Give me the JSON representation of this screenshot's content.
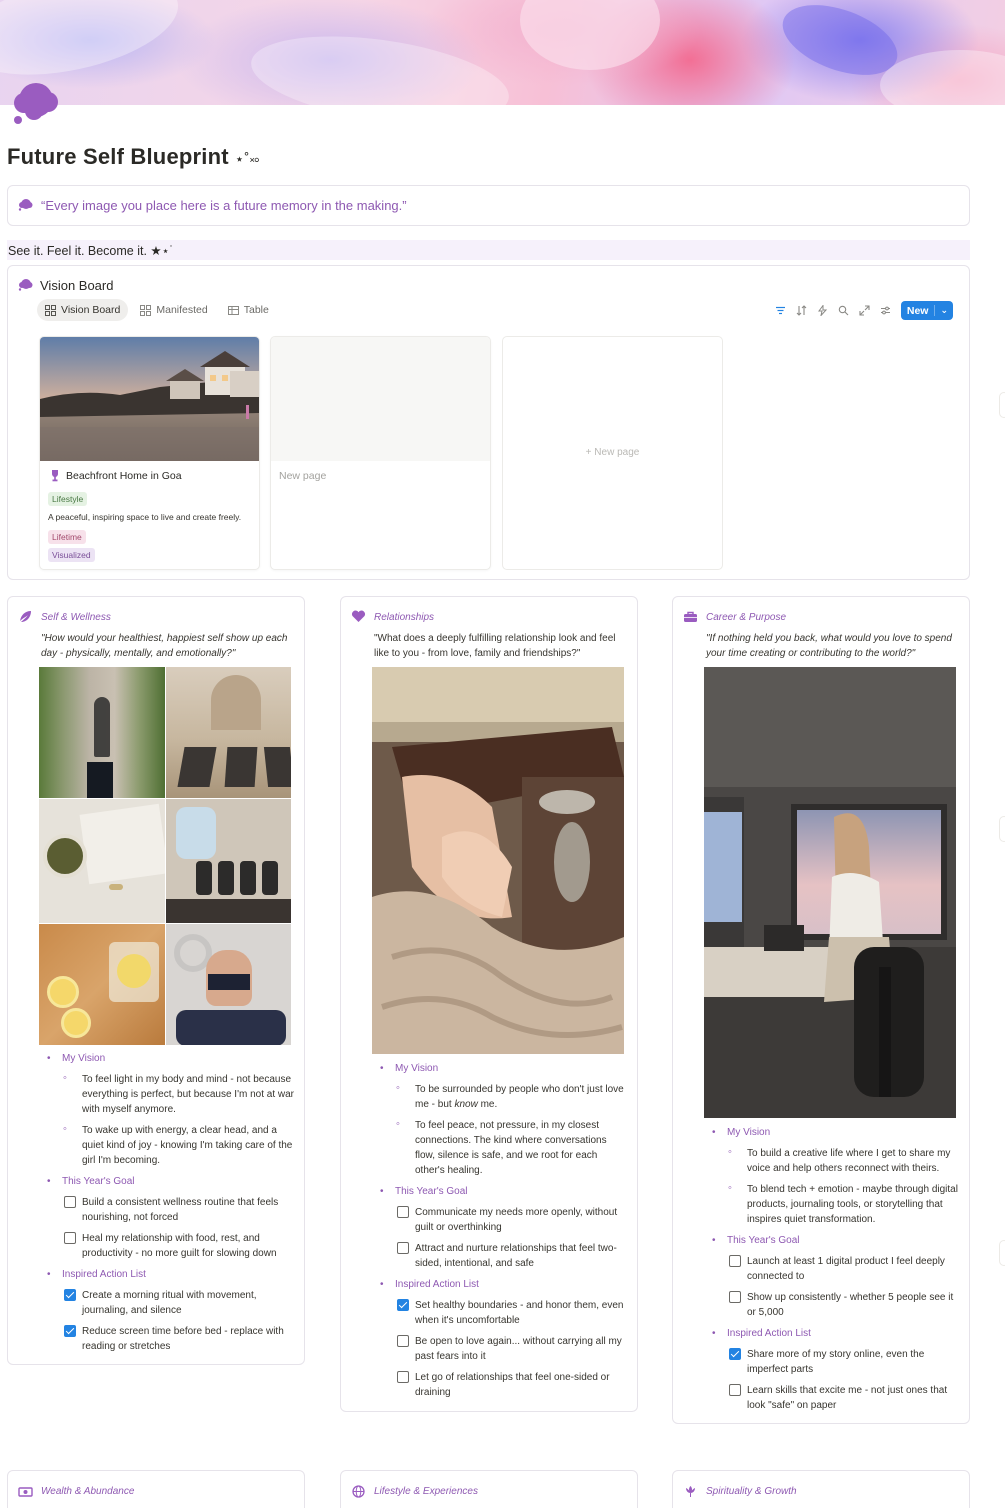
{
  "page": {
    "title": "Future Self Blueprint",
    "title_sparkle": "⋆˚࿎",
    "quote": "“Every image you place here is a future memory in the making.”",
    "tagline": "See it. Feel it. Become it. ★⋆˙"
  },
  "database": {
    "title": "Vision Board",
    "views": [
      {
        "label": "Vision Board",
        "icon": "gallery-icon"
      },
      {
        "label": "Manifested",
        "icon": "gallery-icon"
      },
      {
        "label": "Table",
        "icon": "table-icon"
      }
    ],
    "tools": [
      "filter-icon",
      "sort-icon",
      "lightning-icon",
      "search-icon",
      "expand-icon",
      "settings-icon"
    ],
    "new_label": "New",
    "cards": [
      {
        "name": "Beachfront Home in Goa",
        "category": "Lifestyle",
        "description": "A peaceful, inspiring space to live and create freely.",
        "timeframe": "Lifetime",
        "status": "Visualized"
      },
      {
        "name": "New page"
      }
    ],
    "add_label": "+ New page"
  },
  "sections": [
    {
      "title": "Self & Wellness",
      "icon": "feather-icon",
      "question": "\"How would your healthiest, happiest self show up each day - physically, mentally, and emotionally?\"",
      "vision_label": "My Vision",
      "vision": [
        "To feel light in my body and mind - not because everything is perfect, but because I'm not at war with myself anymore.",
        "To wake up with energy, a clear head, and a quiet kind of joy - knowing I'm taking care of the girl I'm becoming."
      ],
      "goal_label": "This Year's Goal",
      "goals": [
        {
          "text": "Build a consistent wellness routine that feels nourishing, not forced",
          "done": false
        },
        {
          "text": "Heal my relationship with food, rest, and productivity - no more guilt for slowing down",
          "done": false
        }
      ],
      "actions_label": "Inspired Action List",
      "actions": [
        {
          "text": "Create a morning ritual with movement, journaling, and silence",
          "done": true
        },
        {
          "text": "Reduce screen time before bed - replace with reading or stretches",
          "done": true
        }
      ]
    },
    {
      "title": "Relationships",
      "icon": "heart-icon",
      "question": "\"What does a deeply fulfilling relationship look and feel like to you - from love, family and friendships?\"",
      "vision_label": "My Vision",
      "vision_1_pre": "To be surrounded by people who don't just love me - but ",
      "vision_1_em": "know",
      "vision_1_post": " me.",
      "vision_2": "To feel peace, not pressure, in my closest connections. The kind where conversations flow, silence is safe, and we root for each other's healing.",
      "goal_label": "This Year's Goal",
      "goals": [
        {
          "text": "Communicate my needs more openly, without guilt or overthinking",
          "done": false
        },
        {
          "text": "Attract and nurture relationships that feel two-sided, intentional, and safe",
          "done": false
        }
      ],
      "actions_label": "Inspired Action List",
      "actions": [
        {
          "text": "Set healthy boundaries - and honor them, even when it's uncomfortable",
          "done": true
        },
        {
          "text": "Be open to love again... without carrying all my past fears into it",
          "done": false
        },
        {
          "text": "Let go of relationships that feel one-sided or draining",
          "done": false
        }
      ]
    },
    {
      "title": "Career & Purpose",
      "icon": "briefcase-icon",
      "question": "\"If nothing held you back, what would you love to spend your time creating or contributing to the world?\"",
      "vision_label": "My Vision",
      "vision": [
        "To build a creative life where I get to share my voice and help others reconnect with theirs.",
        "To blend tech + emotion - maybe through digital products, journaling tools, or storytelling that inspires quiet transformation."
      ],
      "goal_label": "This Year's Goal",
      "goals": [
        {
          "text": "Launch at least 1 digital product I feel deeply connected to",
          "done": false
        },
        {
          "text": "Show up consistently - whether 5 people see it or 5,000",
          "done": false
        }
      ],
      "actions_label": "Inspired Action List",
      "actions": [
        {
          "text": "Share more of my story online, even the imperfect parts",
          "done": true
        },
        {
          "text": "Learn skills that excite me - not just ones that look \"safe\" on paper",
          "done": false
        }
      ]
    }
  ],
  "bottom_sections": [
    {
      "title": "Wealth & Abundance",
      "icon": "money-icon"
    },
    {
      "title": "Lifestyle & Experiences",
      "icon": "globe-icon"
    },
    {
      "title": "Spirituality & Growth",
      "icon": "lotus-icon"
    }
  ],
  "colors": {
    "accent": "#8e59b2",
    "checkbox": "#2383e2",
    "new_button": "#2383e2",
    "callout_border": "#e6e3ea"
  }
}
